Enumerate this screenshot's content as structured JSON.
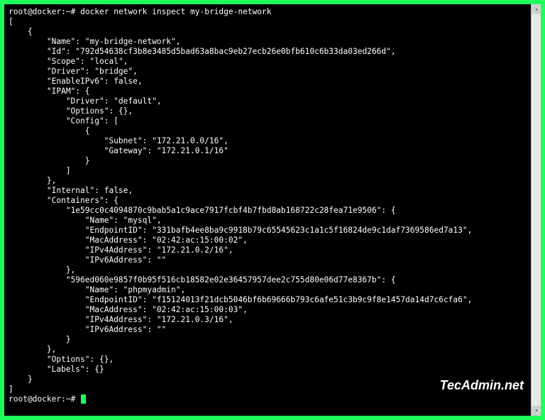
{
  "prompt": {
    "user_host": "root@docker",
    "cwd": "~",
    "separator": ":",
    "symbol": "#"
  },
  "command": "docker network inspect my-bridge-network",
  "output_open": "[",
  "output_close": "]",
  "network": {
    "Name": "my-bridge-network",
    "Id": "792d54638cf3b8e3485d5bad63a8bac9eb27ecb26e0bfb610c6b33da03ed266d",
    "Scope": "local",
    "Driver": "bridge",
    "EnableIPv6": "false",
    "IPAM": {
      "Driver": "default",
      "Options": "{}",
      "Config": {
        "Subnet": "172.21.0.0/16",
        "Gateway": "172.21.0.1/16"
      }
    },
    "Internal": "false",
    "Containers": {
      "c1_id": "1e59cc0c4094870c9bab5a1c9ace7917fcbf4b7fbd8ab168722c28fea71e9506",
      "c1": {
        "Name": "mysql",
        "EndpointID": "331bafb4ee8ba9c9918b79c65545623c1a1c5f16824de9c1daf7369586ed7a13",
        "MacAddress": "02:42:ac:15:00:02",
        "IPv4Address": "172.21.0.2/16",
        "IPv6Address": ""
      },
      "c2_id": "596ed060e9857f0b95f516cb18582e02e36457957dee2c755d80e06d77e8367b",
      "c2": {
        "Name": "phpmyadmin",
        "EndpointID": "f15124013f21dcb5046bf6b69666b793c6afe51c3b9c9f8e1457da14d7c6cfa6",
        "MacAddress": "02:42:ac:15:00:03",
        "IPv4Address": "172.21.0.3/16",
        "IPv6Address": ""
      }
    },
    "Options": "{}",
    "Labels": "{}"
  },
  "watermark": "TecAdmin.net",
  "scrollbar": {
    "up_glyph": "▴",
    "down_glyph": "▾"
  }
}
